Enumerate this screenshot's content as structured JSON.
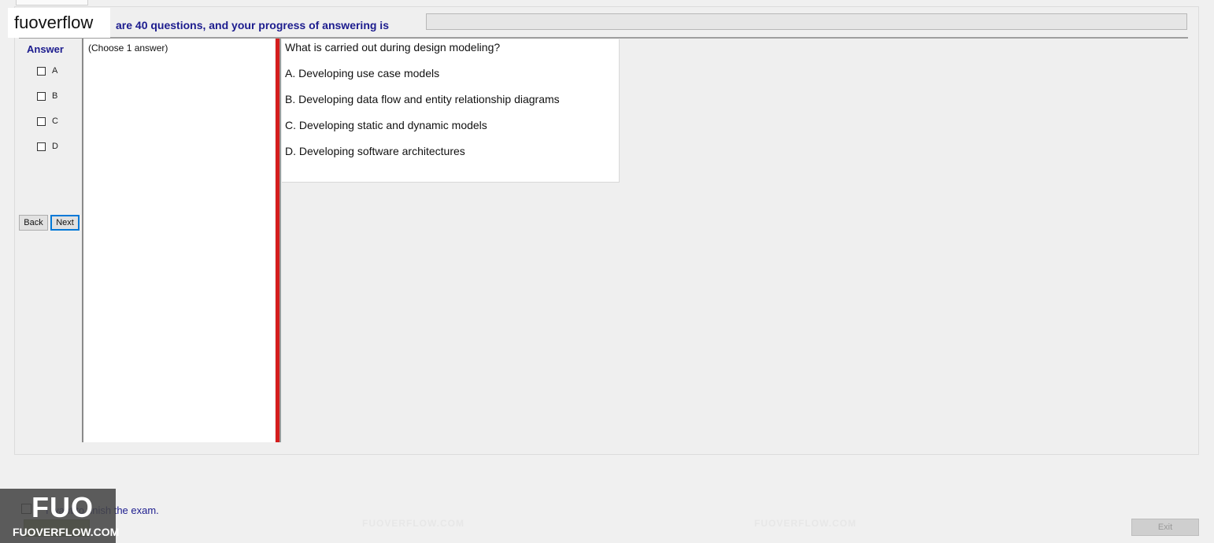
{
  "watermark_brand": "fuoverflow",
  "header": {
    "progress_caption": "are 40 questions, and your progress of answering is",
    "progress_percent": 0
  },
  "answer_panel": {
    "title": "Answer",
    "options": [
      "A",
      "B",
      "C",
      "D"
    ],
    "back_label": "Back",
    "next_label": "Next"
  },
  "choose_panel": {
    "text": "(Choose 1 answer)"
  },
  "question": {
    "text": "What is carried out during design modeling?",
    "options": [
      "A.  Developing use case models",
      "B.  Developing data flow and entity relationship diagrams",
      "C.  Developing static and dynamic models",
      "D.  Developing software architectures"
    ]
  },
  "footer": {
    "finish_label": "I want to finish the exam.",
    "exit_label": "Exit"
  },
  "background_watermark": "FUOVERFLOW.COM",
  "badge": {
    "big": "FUO",
    "small": "FUOVERFLOW.COM"
  }
}
